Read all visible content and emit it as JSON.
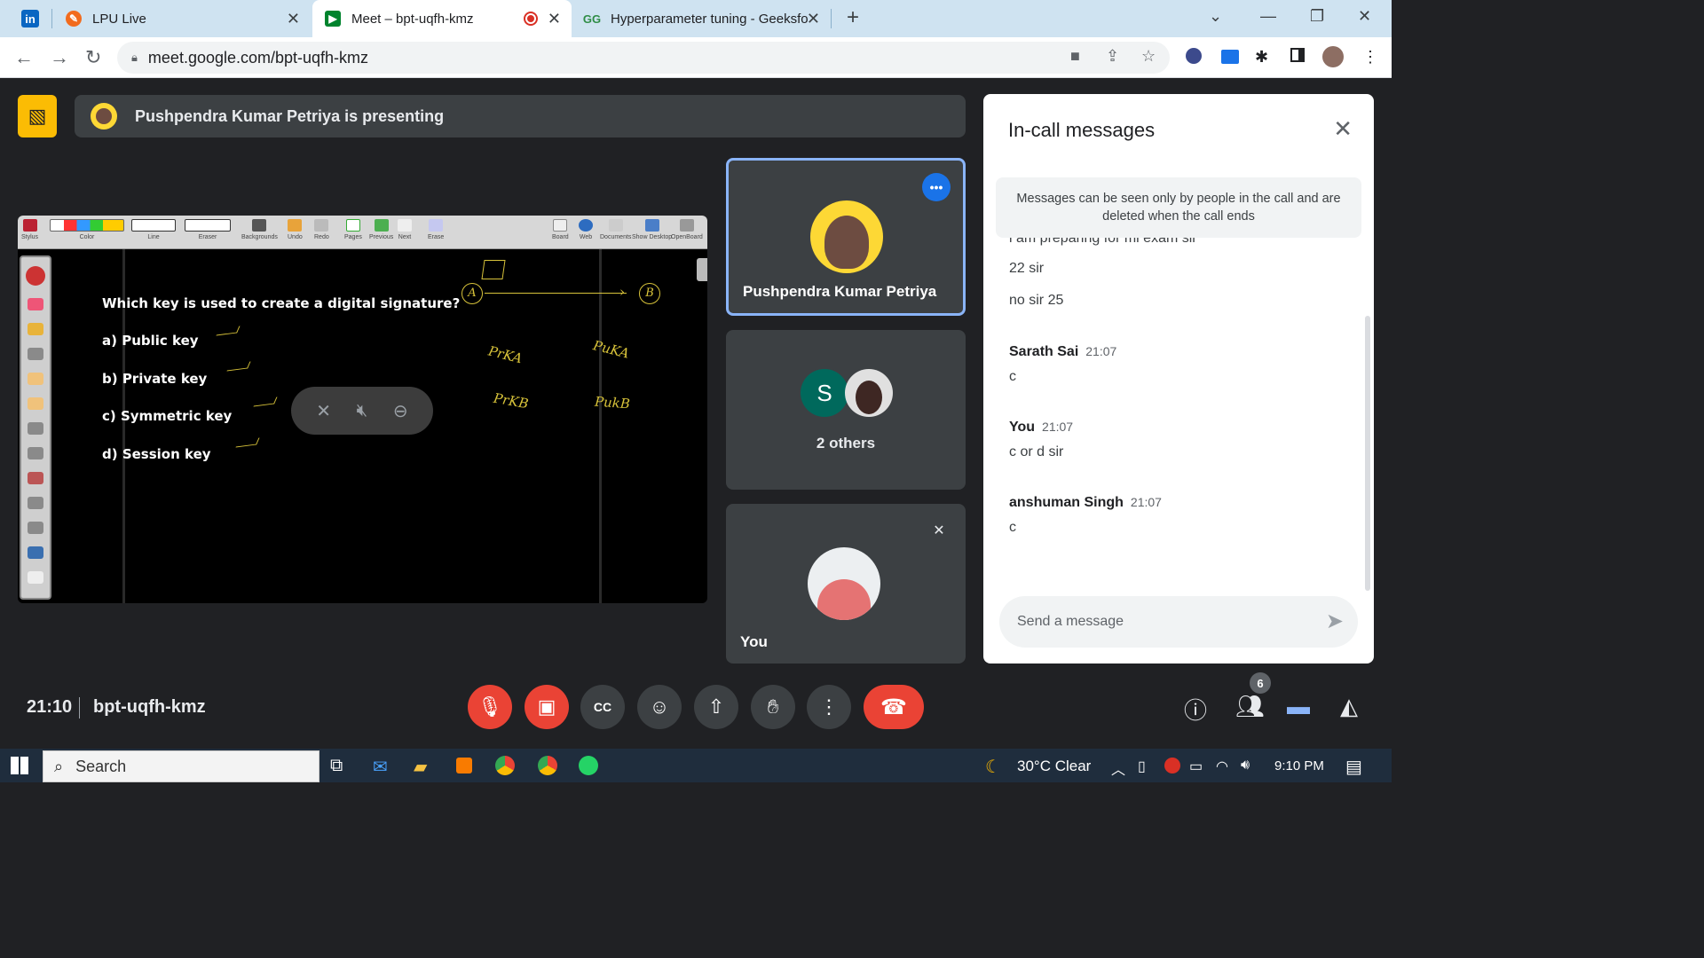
{
  "browser": {
    "tabs": [
      {
        "title": "LPU Live",
        "favicon": "lpu-icon"
      },
      {
        "title": "Meet – bpt-uqfh-kmz",
        "favicon": "meet-icon",
        "active": true
      },
      {
        "title": "Hyperparameter tuning - Geeksfo",
        "favicon": "gfg-icon"
      }
    ],
    "url": "meet.google.com/bpt-uqfh-kmz"
  },
  "meet": {
    "presenting_label": "Pushpendra Kumar Petriya is presenting",
    "presenter_name": "Pushpendra Kumar Petriya",
    "others_label": "2 others",
    "others_initial": "S",
    "you_label": "You",
    "time": "21:10",
    "meeting_code": "bpt-uqfh-kmz",
    "participants_count": "6",
    "accent": "#8ab4f8",
    "end_call_color": "#ea4335"
  },
  "board": {
    "toolbar_labels": [
      "Stylus",
      "Color",
      "Line",
      "Eraser",
      "Backgrounds",
      "Undo",
      "Redo",
      "Pages",
      "Previous",
      "Next",
      "Erase",
      "Board",
      "Web",
      "Documents",
      "Show Desktop",
      "OpenBoard"
    ],
    "question": "Which key is used to create a digital signature?",
    "options": [
      "a) Public key",
      "b) Private key",
      "c) Symmetric key",
      "d) Session key"
    ],
    "notes": {
      "a": "A",
      "b": "B",
      "prka": "PrKA",
      "puka": "PuKA",
      "prkb": "PrKB",
      "pukb": "PukB"
    }
  },
  "chat": {
    "title": "In-call messages",
    "note": "Messages can be seen only by people in the call and are deleted when the call ends",
    "messages": [
      {
        "text": "i am preparing for mi exam sir"
      },
      {
        "text": "22 sir"
      },
      {
        "text": "no sir 25"
      },
      {
        "sender": "Sarath Sai",
        "time": "21:07",
        "text": "c"
      },
      {
        "sender": "You",
        "time": "21:07",
        "text": "c or d sir"
      },
      {
        "sender": "anshuman Singh",
        "time": "21:07",
        "text": "c"
      }
    ],
    "placeholder": "Send a message"
  },
  "taskbar": {
    "search_label": "Search",
    "weather": "30°C  Clear",
    "time": "9:10 PM"
  }
}
